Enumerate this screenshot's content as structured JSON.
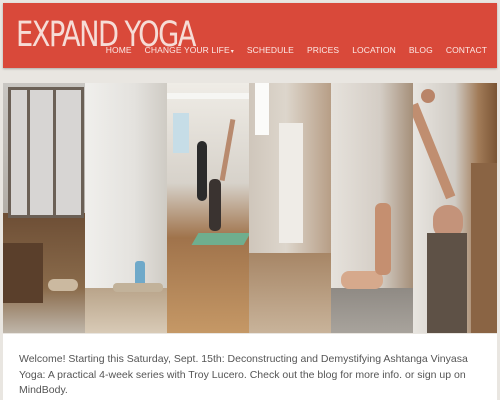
{
  "brand": {
    "name": "EXPAND YOGA"
  },
  "nav": {
    "items": [
      {
        "label": "HOME"
      },
      {
        "label": "CHANGE YOUR LIFE",
        "has_dropdown": true
      },
      {
        "label": "SCHEDULE"
      },
      {
        "label": "PRICES"
      },
      {
        "label": "LOCATION"
      },
      {
        "label": "BLOG"
      },
      {
        "label": "CONTACT"
      }
    ],
    "dropdown_glyph": "▾"
  },
  "gallery": {
    "photos": [
      {
        "name": "studio-window-photo"
      },
      {
        "name": "studio-white-wall-photo"
      },
      {
        "name": "class-standing-pose-photo"
      },
      {
        "name": "studio-bright-window-photo"
      },
      {
        "name": "hand-on-mat-photo"
      },
      {
        "name": "stretching-instructor-photo"
      }
    ]
  },
  "announcement": {
    "text": "Welcome! Starting this Saturday, Sept. 15th: Deconstructing and Demystifying Ashtanga Vinyasa Yoga: A practical 4-week series with Troy Lucero. Check out the blog for more info. or sign up on MindBody."
  },
  "colors": {
    "header": "#d9493a",
    "logo": "#f6dcd6",
    "nav_text": "#fbe9e6",
    "page_bg": "#e9e6e1",
    "body_text": "#555555"
  }
}
